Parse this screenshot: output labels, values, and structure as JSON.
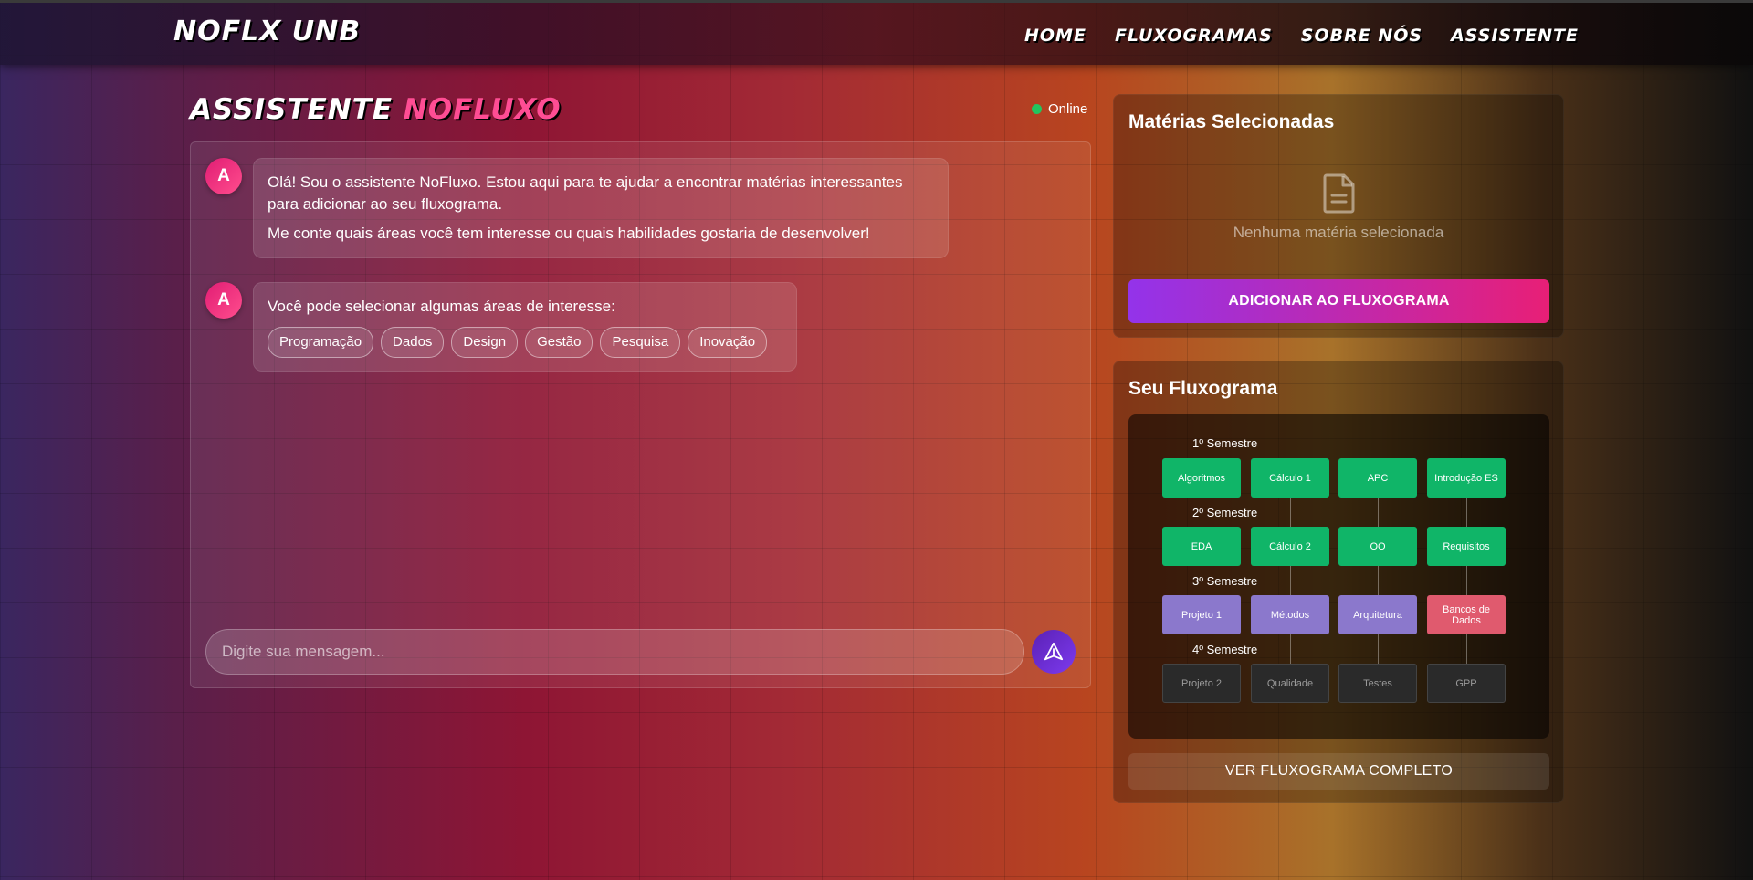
{
  "header": {
    "brand": "NOFLX UNB",
    "nav": [
      "HOME",
      "FLUXOGRAMAS",
      "SOBRE NÓS",
      "ASSISTENTE"
    ]
  },
  "chat": {
    "title_part1": "ASSISTENTE",
    "title_part2": "NOFLUXO",
    "status": "Online",
    "messages": [
      {
        "avatar": "A",
        "paragraphs": [
          "Olá! Sou o assistente NoFluxo. Estou aqui para te ajudar a encontrar matérias interessantes para adicionar ao seu fluxograma.",
          "Me conte quais áreas você tem interesse ou quais habilidades gostaria de desenvolver!"
        ]
      },
      {
        "avatar": "A",
        "paragraphs": [
          "Você pode selecionar algumas áreas de interesse:"
        ],
        "chips": [
          "Programação",
          "Dados",
          "Design",
          "Gestão",
          "Pesquisa",
          "Inovação"
        ]
      }
    ],
    "input_placeholder": "Digite sua mensagem...",
    "send_icon": "send-icon"
  },
  "selected": {
    "title": "Matérias Selecionadas",
    "empty_icon": "document-icon",
    "empty_text": "Nenhuma matéria selecionada",
    "button": "ADICIONAR AO FLUXOGRAMA"
  },
  "flow": {
    "title": "Seu Fluxograma",
    "semesters": [
      {
        "label": "1º Semestre",
        "nodes": [
          {
            "name": "Algoritmos",
            "status": "green"
          },
          {
            "name": "Cálculo 1",
            "status": "green"
          },
          {
            "name": "APC",
            "status": "green"
          },
          {
            "name": "Introdução ES",
            "status": "green"
          }
        ]
      },
      {
        "label": "2º Semestre",
        "nodes": [
          {
            "name": "EDA",
            "status": "green"
          },
          {
            "name": "Cálculo 2",
            "status": "green"
          },
          {
            "name": "OO",
            "status": "green"
          },
          {
            "name": "Requisitos",
            "status": "green"
          }
        ]
      },
      {
        "label": "3º Semestre",
        "nodes": [
          {
            "name": "Projeto 1",
            "status": "purple"
          },
          {
            "name": "Métodos",
            "status": "purple"
          },
          {
            "name": "Arquitetura",
            "status": "purple"
          },
          {
            "name": "Bancos de Dados",
            "status": "red"
          }
        ]
      },
      {
        "label": "4º Semestre",
        "nodes": [
          {
            "name": "Projeto 2",
            "status": "gray"
          },
          {
            "name": "Qualidade",
            "status": "gray"
          },
          {
            "name": "Testes",
            "status": "gray"
          },
          {
            "name": "GPP",
            "status": "gray"
          }
        ]
      }
    ],
    "button": "VER FLUXOGRAMA COMPLETO",
    "colors": {
      "green": "#10b568",
      "purple": "#8b78cc",
      "red": "#e05a6e",
      "gray": "#2a2a2a"
    }
  }
}
